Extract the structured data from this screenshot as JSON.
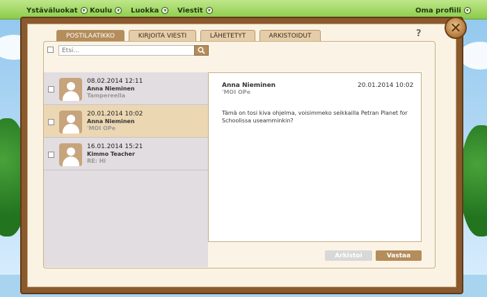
{
  "topbar": {
    "menu": [
      {
        "label": "Ystäväluokat"
      },
      {
        "label": "Koulu"
      },
      {
        "label": "Luokka"
      },
      {
        "label": "Viestit"
      }
    ],
    "profile_label": "Oma profiili"
  },
  "tabs": [
    {
      "label": "POSTILAATIKKO",
      "active": true
    },
    {
      "label": "KIRJOITA VIESTI",
      "active": false
    },
    {
      "label": "LÄHETETYT",
      "active": false
    },
    {
      "label": "ARKISTOIDUT",
      "active": false
    }
  ],
  "help_label": "?",
  "search": {
    "placeholder": "Etsi..."
  },
  "messages": [
    {
      "date": "08.02.2014 12:11",
      "sender": "Anna Nieminen",
      "subject": "Tampereella",
      "selected": false
    },
    {
      "date": "20.01.2014 10:02",
      "sender": "Anna Nieminen",
      "subject": "'MOI OPe",
      "selected": true
    },
    {
      "date": "16.01.2014 15:21",
      "sender": "Kimmo Teacher",
      "subject": "RE: Hi",
      "selected": false
    }
  ],
  "view": {
    "sender": "Anna Nieminen",
    "subject": "'MOI OPe",
    "date": "20.01.2014 10:02",
    "body": "Tämä on tosi kiva ohjelma, voisimmeko seikkailla Petran Planet for Schoolissa useamminkin?"
  },
  "buttons": {
    "archive": "Arkistoi",
    "reply": "Vastaa"
  },
  "colors": {
    "accent": "#b48d5b",
    "frame": "#8a5a2e",
    "topbar": "#8ccb4a"
  }
}
